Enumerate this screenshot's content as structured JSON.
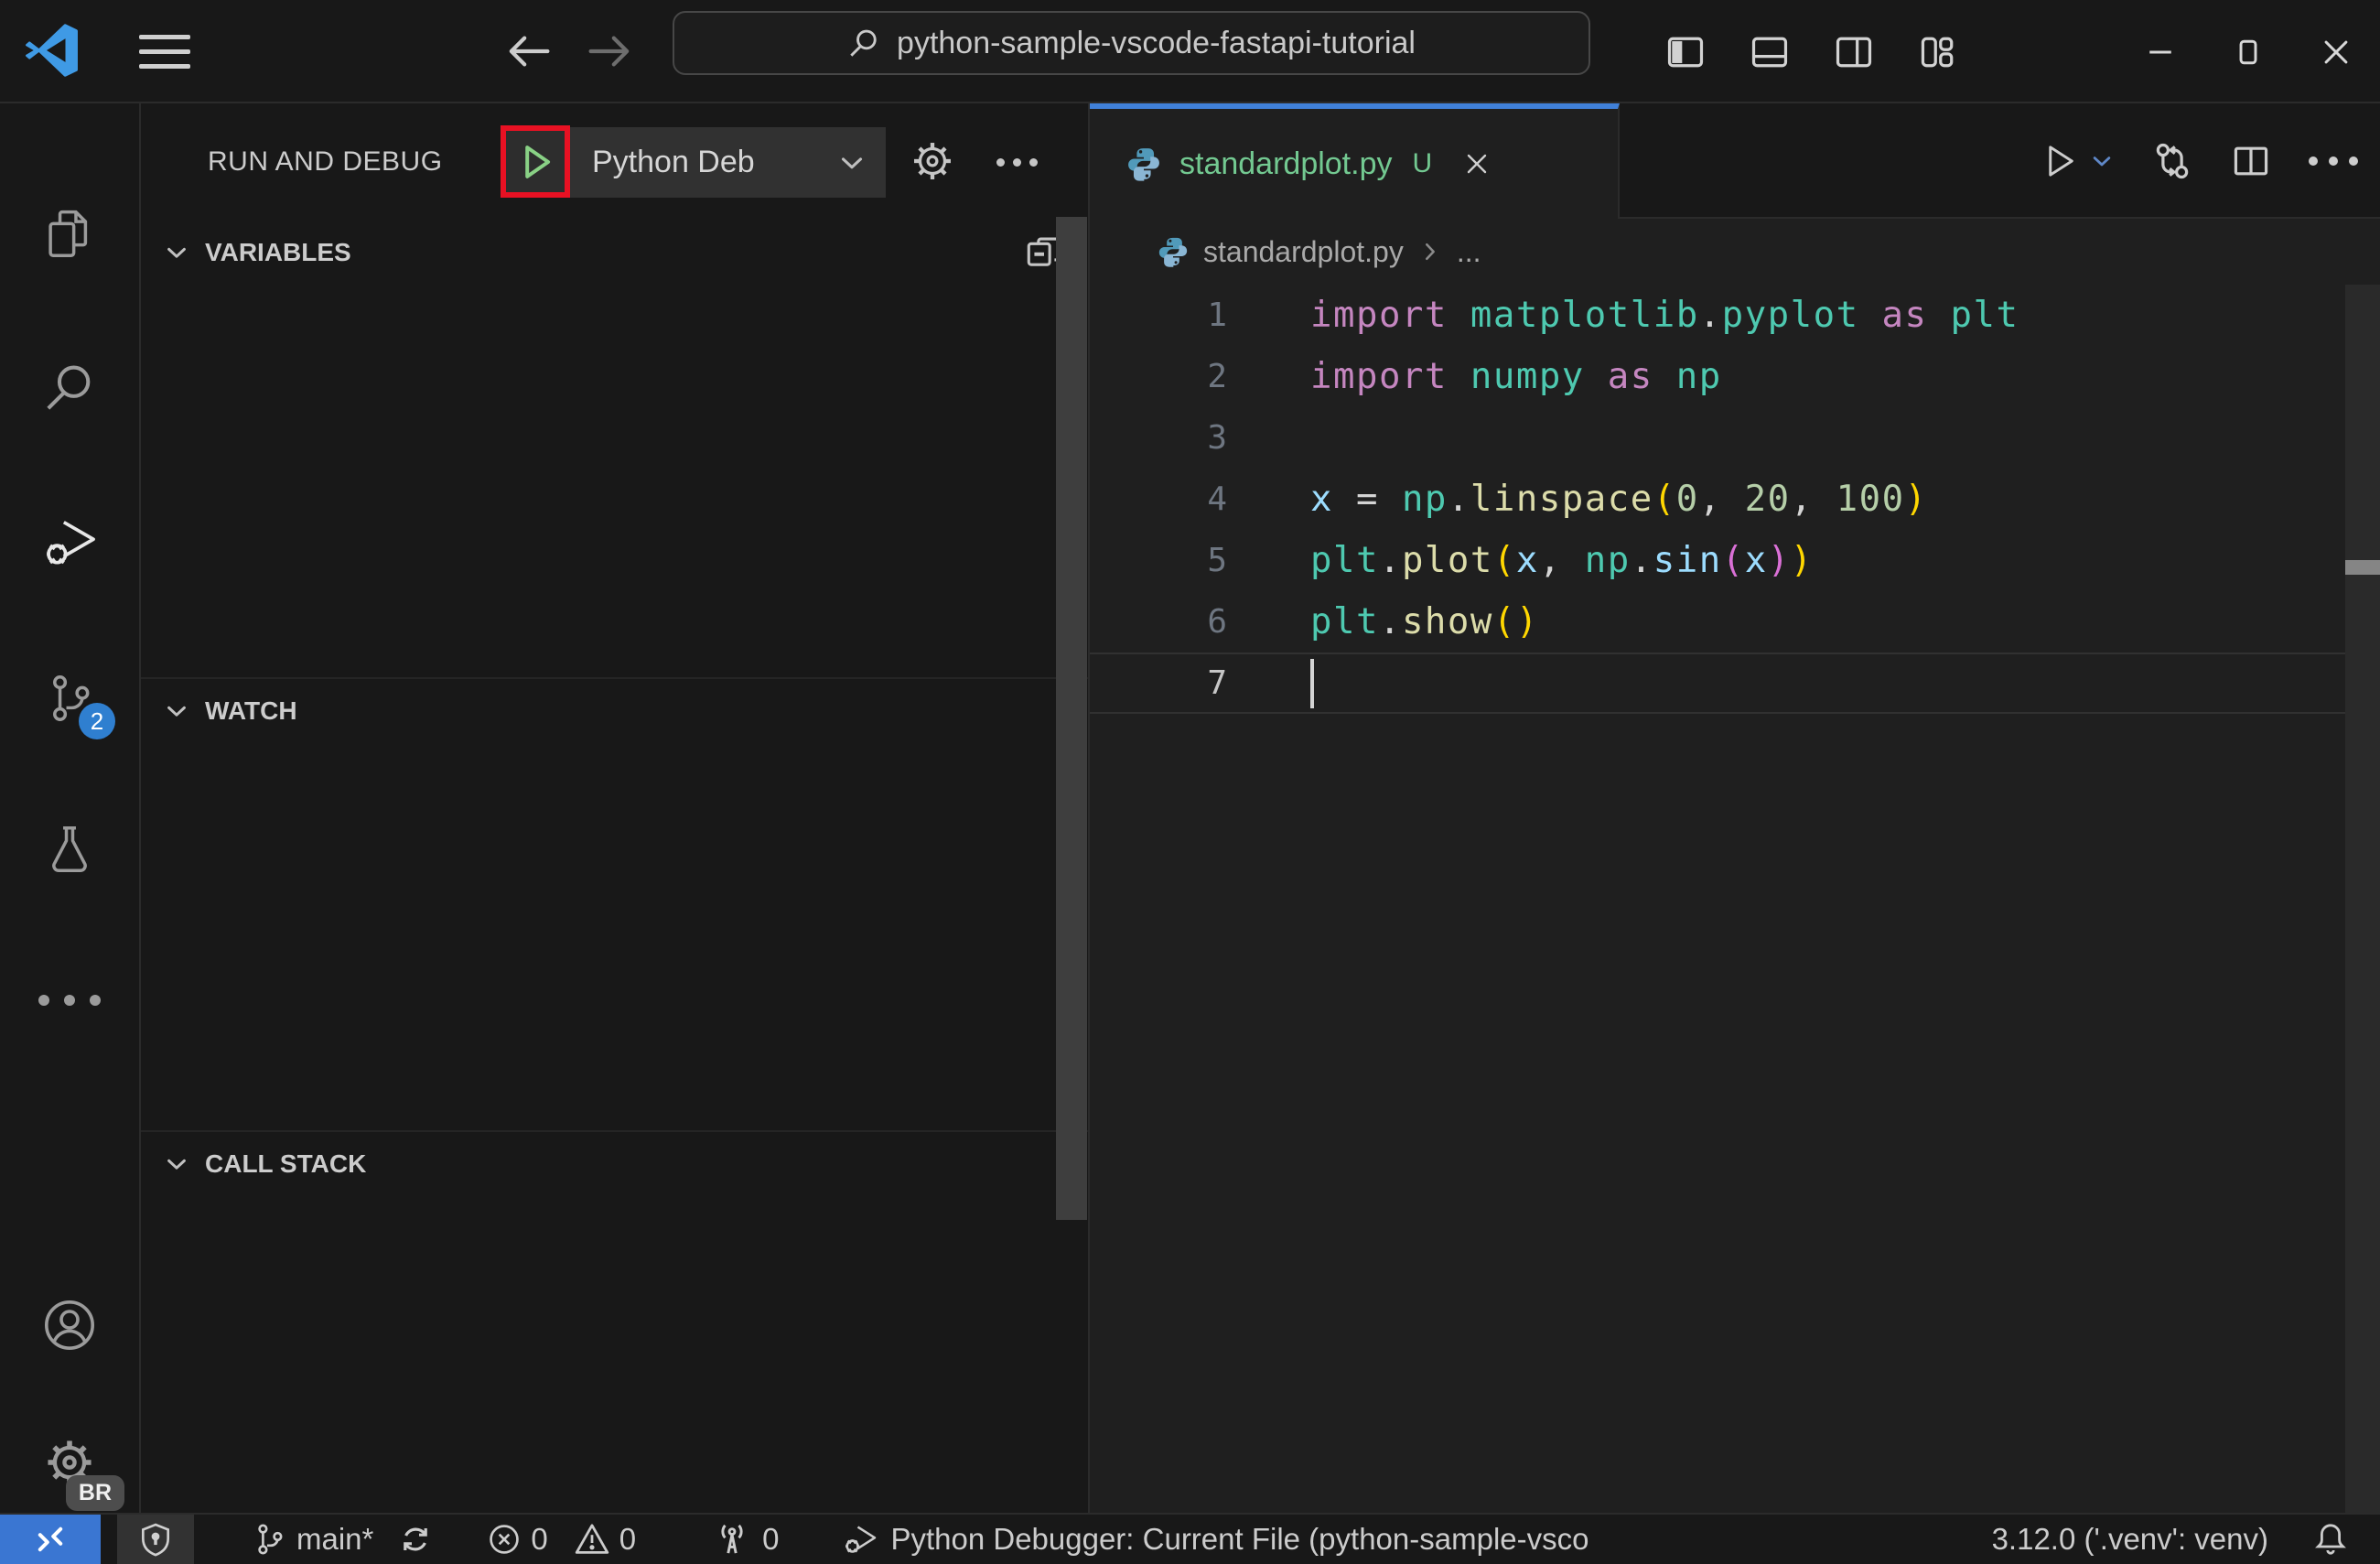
{
  "title_bar": {
    "command_center_text": "python-sample-vscode-fastapi-tutorial"
  },
  "activity_bar": {
    "scm_badge": "2",
    "profile_badge": "BR"
  },
  "sidebar": {
    "title": "RUN AND DEBUG",
    "debug_config": "Python Deb",
    "sections": {
      "variables": "VARIABLES",
      "watch": "WATCH",
      "call_stack": "CALL STACK"
    }
  },
  "editor": {
    "tab": {
      "label": "standardplot.py",
      "modified_badge": "U"
    },
    "breadcrumb": {
      "file": "standardplot.py",
      "symbol": "..."
    },
    "code": {
      "lines": [
        {
          "num": "1",
          "tokens": [
            [
              "import",
              "kw"
            ],
            [
              " ",
              "pun"
            ],
            [
              "matplotlib",
              "mod"
            ],
            [
              ".",
              "pun"
            ],
            [
              "pyplot",
              "mod"
            ],
            [
              " ",
              "pun"
            ],
            [
              "as",
              "kw"
            ],
            [
              " ",
              "pun"
            ],
            [
              "plt",
              "mod"
            ]
          ]
        },
        {
          "num": "2",
          "tokens": [
            [
              "import",
              "kw"
            ],
            [
              " ",
              "pun"
            ],
            [
              "numpy",
              "mod"
            ],
            [
              " ",
              "pun"
            ],
            [
              "as",
              "kw"
            ],
            [
              " ",
              "pun"
            ],
            [
              "np",
              "mod"
            ]
          ]
        },
        {
          "num": "3",
          "tokens": []
        },
        {
          "num": "4",
          "tokens": [
            [
              "x",
              "var"
            ],
            [
              " = ",
              "pun"
            ],
            [
              "np",
              "mod"
            ],
            [
              ".",
              "pun"
            ],
            [
              "linspace",
              "fn"
            ],
            [
              "(",
              "b1"
            ],
            [
              "0",
              "num"
            ],
            [
              ", ",
              "pun"
            ],
            [
              "20",
              "num"
            ],
            [
              ", ",
              "pun"
            ],
            [
              "100",
              "num"
            ],
            [
              ")",
              "b1"
            ]
          ]
        },
        {
          "num": "5",
          "tokens": [
            [
              "plt",
              "mod"
            ],
            [
              ".",
              "pun"
            ],
            [
              "plot",
              "fn"
            ],
            [
              "(",
              "b1"
            ],
            [
              "x",
              "var"
            ],
            [
              ", ",
              "pun"
            ],
            [
              "np",
              "mod"
            ],
            [
              ".",
              "pun"
            ],
            [
              "sin",
              "var"
            ],
            [
              "(",
              "b2"
            ],
            [
              "x",
              "var"
            ],
            [
              ")",
              "b2"
            ],
            [
              ")",
              "b1"
            ]
          ]
        },
        {
          "num": "6",
          "tokens": [
            [
              "plt",
              "mod"
            ],
            [
              ".",
              "pun"
            ],
            [
              "show",
              "fn"
            ],
            [
              "(",
              "b1"
            ],
            [
              ")",
              "b1"
            ]
          ]
        },
        {
          "num": "7",
          "tokens": [],
          "current": true,
          "cursor": true
        }
      ]
    }
  },
  "status_bar": {
    "branch": "main*",
    "errors": "0",
    "warnings": "0",
    "ports": "0",
    "debug_status": "Python Debugger: Current File (python-sample-vsco",
    "interpreter": "3.12.0 ('.venv': venv)"
  },
  "icons": {
    "remote": "remote-connect",
    "shield": "workspace-trust-shield",
    "source_control": "git-branch",
    "sync": "sync-refresh",
    "errors": "circle-cross",
    "warnings": "triangle-exclamation",
    "ports": "radio-tower",
    "debugger": "bug-play",
    "bell": "notifications-bell",
    "search": "magnifier",
    "more": "ellipsis"
  },
  "colors": {
    "accent_blue": "#4080d8",
    "remote_blue": "#3a76d2",
    "badge_blue": "#2f7fd0",
    "run_green": "#89d185",
    "untracked_green": "#73c991",
    "annotation_red": "#e81123"
  }
}
